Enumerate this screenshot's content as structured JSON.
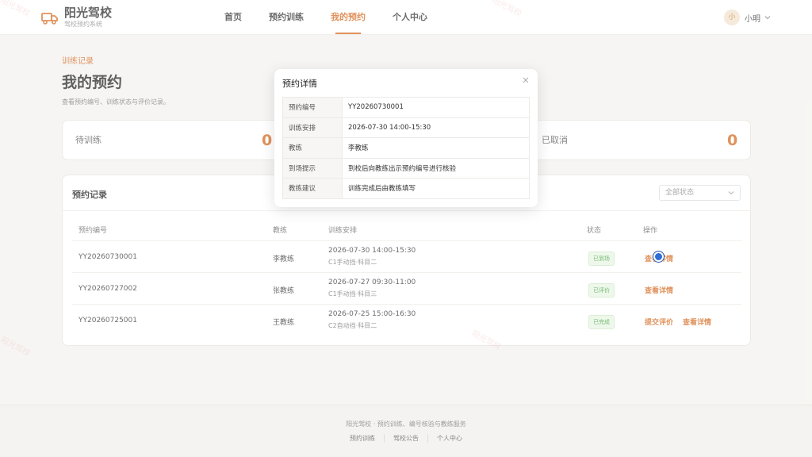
{
  "app": {
    "title": "阳光驾校",
    "subtitle": "驾校预约系统"
  },
  "nav": [
    {
      "label": "首页",
      "active": false
    },
    {
      "label": "预约训练",
      "active": false
    },
    {
      "label": "我的预约",
      "active": true
    },
    {
      "label": "个人中心",
      "active": false
    }
  ],
  "user": {
    "avatar_text": "小",
    "name": "小明"
  },
  "page": {
    "crumb": "训练记录",
    "title": "我的预约",
    "desc": "查看预约编号、训练状态与评价记录。"
  },
  "stats": [
    {
      "label": "待训练",
      "value": "0"
    },
    {
      "label": "已取消",
      "value": "0"
    }
  ],
  "records": {
    "title": "预约记录",
    "filter": "全部状态",
    "columns": [
      "预约编号",
      "教练",
      "训练安排",
      "状态",
      "操作"
    ],
    "rows": [
      {
        "id": "YY20260730001",
        "coach": "李教练",
        "time": "2026-07-30 14:00-15:30",
        "course": "C1手动挡·科目二",
        "status": "已到场",
        "actions": [
          "查看详情"
        ]
      },
      {
        "id": "YY20260727002",
        "coach": "张教练",
        "time": "2026-07-27 09:30-11:00",
        "course": "C1手动挡·科目三",
        "status": "已评价",
        "actions": [
          "查看详情"
        ]
      },
      {
        "id": "YY20260725001",
        "coach": "王教练",
        "time": "2026-07-25 15:00-16:30",
        "course": "C2自动挡·科目二",
        "status": "已完成",
        "actions": [
          "提交评价",
          "查看详情"
        ]
      }
    ]
  },
  "modal": {
    "title": "预约详情",
    "close": "×",
    "fields": [
      {
        "key": "预约编号",
        "value": "YY20260730001"
      },
      {
        "key": "训练安排",
        "value": "2026-07-30 14:00-15:30"
      },
      {
        "key": "教练",
        "value": "李教练"
      },
      {
        "key": "到场提示",
        "value": "到校后向教练出示预约编号进行核验"
      },
      {
        "key": "教练建议",
        "value": "训练完成后由教练填写"
      }
    ]
  },
  "footer": {
    "text": "阳光驾校 · 预约训练、编号核验与教练服务",
    "links": [
      "预约训练",
      "驾校公告",
      "个人中心"
    ]
  },
  "watermark": "阳光驾校",
  "colors": {
    "accent": "#d4691f",
    "badge_green": "#3f9f3a"
  }
}
